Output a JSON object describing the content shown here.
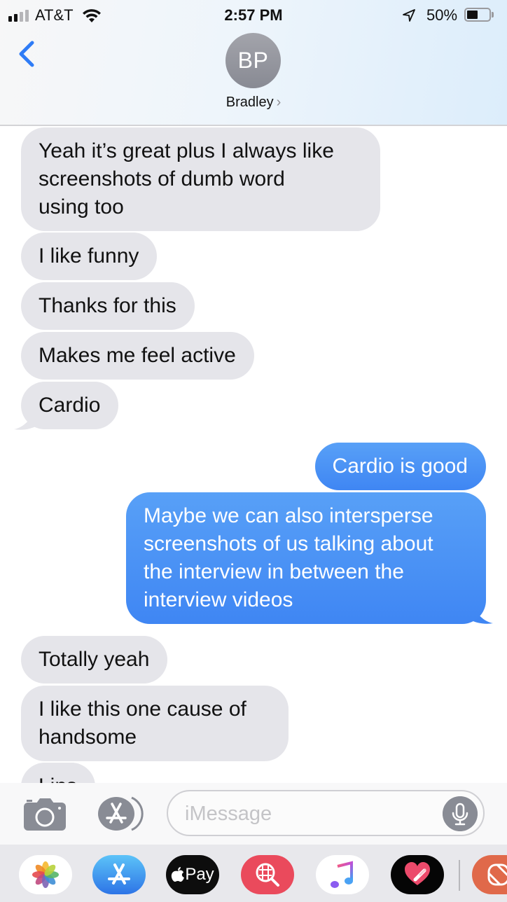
{
  "status_bar": {
    "carrier": "AT&T",
    "time": "2:57 PM",
    "battery_percent": "50%",
    "battery_level": 0.5,
    "signal_bars_active": 2,
    "signal_bars_total": 4
  },
  "header": {
    "back_icon": "chevron-left-icon",
    "avatar_initials": "BP",
    "contact_name": "Bradley",
    "contact_chevron": "›"
  },
  "colors": {
    "accent_blue": "#3f86f3",
    "received_bubble": "#e5e5ea",
    "icon_gray": "#898c95"
  },
  "messages": [
    {
      "direction": "received",
      "text": "Yeah it’s great plus I always like\nscreenshots of dumb word\nusing too"
    },
    {
      "direction": "received",
      "text": "I like funny"
    },
    {
      "direction": "received",
      "text": "Thanks for this"
    },
    {
      "direction": "received",
      "text": "Makes me feel active"
    },
    {
      "direction": "received",
      "text": "Cardio"
    },
    {
      "direction": "sent",
      "text": "Cardio is good"
    },
    {
      "direction": "sent",
      "text": "Maybe we can also intersperse\nscreenshots of us talking about\nthe interview in between the\ninterview videos"
    },
    {
      "direction": "received",
      "text": "Totally yeah"
    },
    {
      "direction": "received",
      "text": "I like this one cause of\nhandsome"
    },
    {
      "direction": "received",
      "text": "Lins"
    }
  ],
  "input_bar": {
    "camera_icon": "camera-icon",
    "apps_icon": "app-store-icon",
    "placeholder": "iMessage",
    "value": "",
    "mic_icon": "microphone-icon"
  },
  "app_drawer": {
    "apps": [
      {
        "name": "Photos",
        "icon": "photos-icon"
      },
      {
        "name": "App Store",
        "icon": "app-store-icon"
      },
      {
        "name": "Apple Pay",
        "icon": "apple-pay-icon",
        "label": "Pay"
      },
      {
        "name": "Image Search",
        "icon": "globe-search-icon"
      },
      {
        "name": "Music",
        "icon": "music-note-icon"
      },
      {
        "name": "Digital Touch",
        "icon": "heart-icon"
      },
      {
        "name": "Memoji Stickers",
        "icon": "stickers-icon"
      }
    ]
  }
}
